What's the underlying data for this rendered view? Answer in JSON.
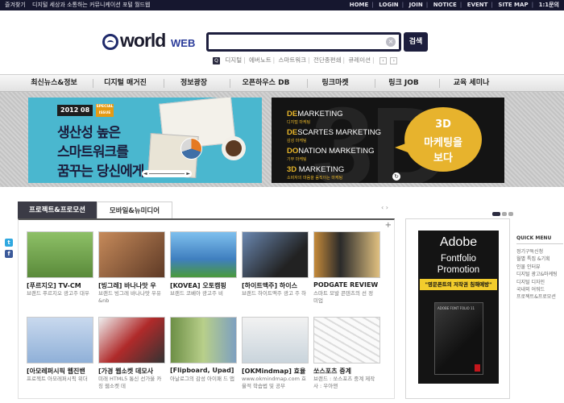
{
  "topbar": {
    "bookmark": "즐겨찾기",
    "slogan": "디지털 세상과 소통하는 커뮤니케이션 포털 월드웹",
    "links": [
      "HOME",
      "LOGIN",
      "JOIN",
      "NOTICE",
      "EVENT",
      "SITE MAP",
      "1:1문의"
    ]
  },
  "logo": {
    "word": "world",
    "suffix": "WEB"
  },
  "search": {
    "value": "",
    "placeholder": "",
    "clear": "×",
    "button": "검색"
  },
  "keywords": {
    "icon": "Q",
    "items": [
      "디지털",
      "에버노트",
      "스마트워크",
      "전단종편쇄",
      "큐레이션"
    ],
    "prev": "‹",
    "next": "›"
  },
  "nav": [
    "최신뉴스&정보",
    "디지털 매거진",
    "정보광장",
    "오픈하우스 DB",
    "링크마켓",
    "링크 JOB",
    "교육 세미나"
  ],
  "banner_left": {
    "date": "2012 08",
    "badge_line1": "SPECIAL",
    "badge_line2": "ISSUE",
    "line1": "생산성 높은",
    "line2": "스마트워크를",
    "line3": "꿈꾸는 당신에게",
    "slider_prev": "◄",
    "slider_next": "►"
  },
  "banner_right": {
    "big": "3D",
    "lines": [
      {
        "hl": "DE",
        "rest": "MARKETING",
        "sub": "디지털 마케팅"
      },
      {
        "hl": "DE",
        "rest": "SCARTES MARKETING",
        "sub": "감성 마케팅"
      },
      {
        "hl": "DO",
        "rest": "NATION MARKETING",
        "sub": "기부 마케팅"
      },
      {
        "hl": "3D",
        "rest": " MARKETING",
        "sub": "소비자의 마음을 움직이는 마케팅"
      }
    ],
    "bubble_line1": "3D",
    "bubble_line2": "마케팅을",
    "bubble_line3": "보다"
  },
  "tabs": {
    "active": "프로젝트&프로모션",
    "inactive": "모바일&뉴미디어",
    "prev": "‹",
    "next": "›"
  },
  "panel_more": "+",
  "cards": [
    {
      "title": "[푸르지오] TV-CM",
      "desc": "브랜드 푸르지오 광고주 대우",
      "thumb": "#7fae54"
    },
    {
      "title": "[빙그레] 바나나맛 우",
      "desc": "브랜드 빙그레 바나나맛 우유&nb",
      "thumb": "#8a5a3c"
    },
    {
      "title": "[KOVEA] 오토캠핑",
      "desc": "브랜드 코베아 광고주 비",
      "thumb": "#5fa0d8"
    },
    {
      "title": "[하이트맥주] 하이스",
      "desc": "브랜드 하이트맥주 광고 주 하",
      "thumb": "#3e4f6b"
    },
    {
      "title": "PODGATE REVIEW",
      "desc": "스마트 모발 콘텐츠의 선 정 미업",
      "thumb": "#2a2a2a"
    },
    {
      "title": "[아모레퍼시픽 웹진밴",
      "desc": "프로젝트 아모레퍼시픽 위더",
      "thumb": "#9fb8d6"
    },
    {
      "title": "[가경 웹소켓 데모사",
      "desc": "미래 HTML5 통신 선가울 카징 웹소켓 데",
      "thumb": "#b02a2a"
    },
    {
      "title": "[Flipboard, Upad]",
      "desc": "아날로그의 감성 아이패 드 앱",
      "thumb": "#6d8f46"
    },
    {
      "title": "[OKMindmap] 효율",
      "desc": "www.okmindmap.com 효율적 학습법 및 공부",
      "thumb": "#d9d9d9"
    },
    {
      "title": "쏘스포츠 중계",
      "desc": "브랜드 : 쏘스포츠 중계 제작사 : 우아앤",
      "thumb": "#efefef"
    }
  ],
  "social": [
    {
      "icon": "twitter-icon",
      "glyph": "t",
      "color": "#2fa8e0"
    },
    {
      "icon": "facebook-icon",
      "glyph": "f",
      "color": "#3b5a9a"
    }
  ],
  "ad": {
    "line1": "Adobe",
    "line2": "Fontfolio",
    "line3": "Promotion",
    "tagline": "\"영문폰트의 저작권 침해예방\"",
    "box_label": "ADOBE FONT FOLIO 11"
  },
  "quick_menu": {
    "title": "QUICK MENU",
    "items": [
      "정기구독신청",
      "월별 특집 &기획",
      "인물 인터뷰",
      "디지털 광고&마케팅",
      "디지털 디자인",
      "국내외 어워드",
      "프로젝트&프로모션"
    ]
  }
}
